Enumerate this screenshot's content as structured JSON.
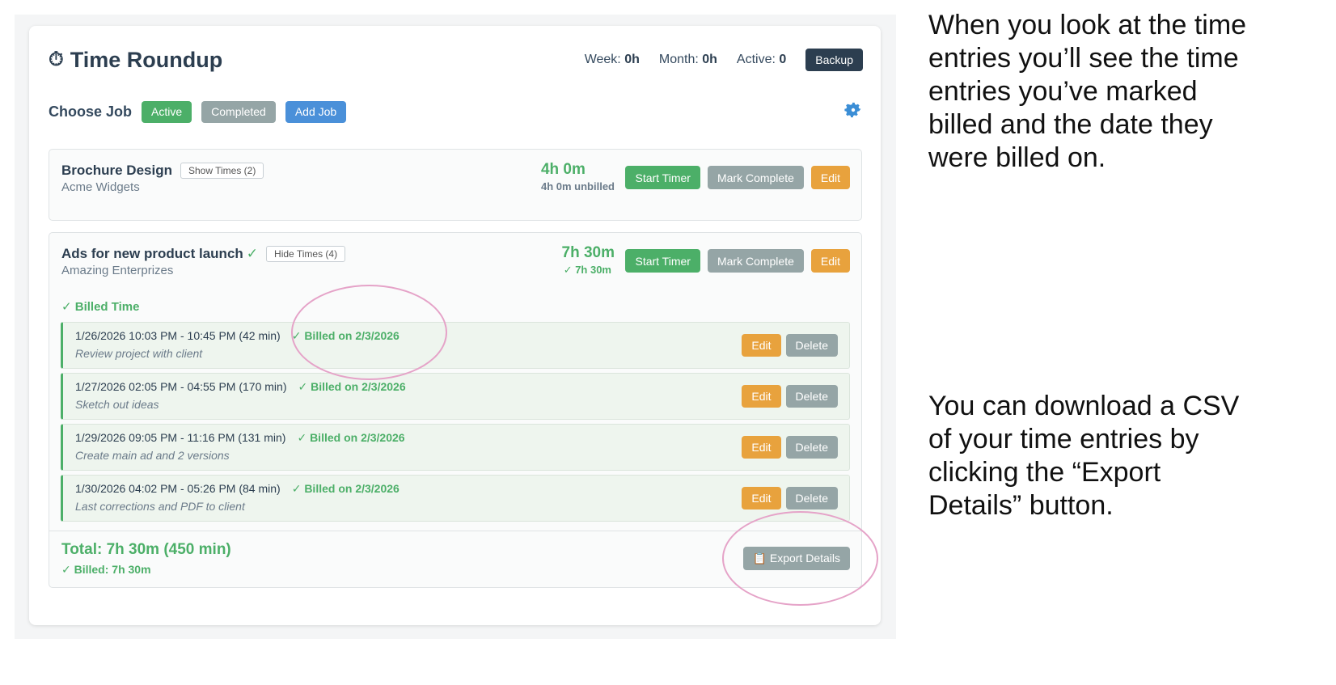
{
  "app": {
    "title": "Time Roundup",
    "stopwatch_icon": "⏱",
    "stats": {
      "week_label": "Week:",
      "week_value": "0h",
      "month_label": "Month:",
      "month_value": "0h",
      "active_label": "Active:",
      "active_value": "0"
    },
    "backup_label": "Backup"
  },
  "choose_job": {
    "label": "Choose Job",
    "filters": [
      "Active",
      "Completed"
    ],
    "add_label": "Add Job",
    "settings_icon": "gear-icon"
  },
  "jobs": [
    {
      "name": "Brochure Design",
      "client": "Acme Widgets",
      "toggle_label": "Show Times (2)",
      "total": "4h 0m",
      "subtotal": "4h 0m unbilled",
      "start_label": "Start Timer",
      "complete_label": "Mark Complete",
      "edit_label": "Edit"
    },
    {
      "name": "Ads for new product launch",
      "check": "✓",
      "client": "Amazing Enterprizes",
      "toggle_label": "Hide Times (4)",
      "total": "7h 30m",
      "subtotal": "✓ 7h 30m",
      "start_label": "Start Timer",
      "complete_label": "Mark Complete",
      "edit_label": "Edit",
      "billed_heading": "✓ Billed Time",
      "entries": [
        {
          "range": "1/26/2026 10:03 PM - 10:45 PM (42 min)",
          "billed": "✓ Billed on 2/3/2026",
          "desc": "Review project with client"
        },
        {
          "range": "1/27/2026 02:05 PM - 04:55 PM (170 min)",
          "billed": "✓ Billed on 2/3/2026",
          "desc": "Sketch out ideas"
        },
        {
          "range": "1/29/2026 09:05 PM - 11:16 PM (131 min)",
          "billed": "✓ Billed on 2/3/2026",
          "desc": "Create main ad and 2 versions"
        },
        {
          "range": "1/30/2026 04:02 PM - 05:26 PM (84 min)",
          "billed": "✓ Billed on 2/3/2026",
          "desc": "Last corrections and PDF to client"
        }
      ],
      "entry_edit_label": "Edit",
      "entry_delete_label": "Delete",
      "total_line": "Total: 7h 30m (450 min)",
      "billed_line": "✓ Billed: 7h 30m",
      "export_label": "📋 Export Details"
    }
  ],
  "annotations": {
    "top": "When you look at the time entries you’ll see the time entries you’ve marked billed and the date they were billed on.",
    "bottom": "You can download a CSV of your time entries by clicking the “Export Details” button."
  },
  "colors": {
    "accent_green": "#4caf68",
    "accent_orange": "#e8a23d",
    "accent_blue": "#4a90d9",
    "muted_gray": "#95a5a6",
    "dark": "#2c3e50",
    "highlight_ellipse": "#e5a3c8"
  }
}
